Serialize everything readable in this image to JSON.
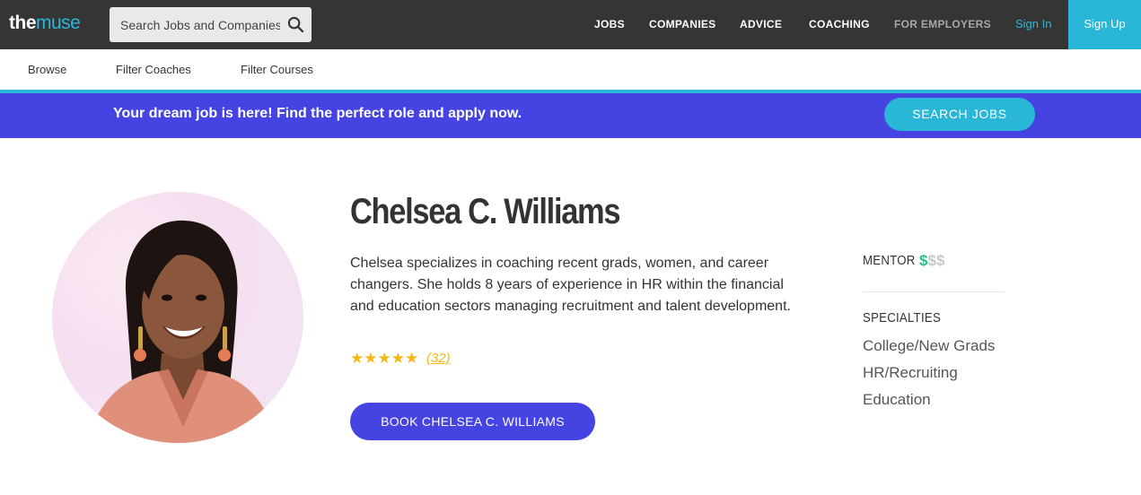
{
  "header": {
    "logo_the": "the",
    "logo_muse": "muse",
    "search_placeholder": "Search Jobs and Companies",
    "nav": [
      "JOBS",
      "COMPANIES",
      "ADVICE",
      "COACHING",
      "FOR EMPLOYERS"
    ],
    "sign_in": "Sign In",
    "sign_up": "Sign Up"
  },
  "subnav": [
    "Browse",
    "Filter Coaches",
    "Filter Courses"
  ],
  "banner": {
    "text": "Your dream job is here! Find the perfect role and apply now.",
    "button": "SEARCH JOBS"
  },
  "profile": {
    "name": "Chelsea C. Williams",
    "bio": "Chelsea specializes in coaching recent grads, women, and career changers. She holds 8 years of experience in HR within the financial and education sectors managing recruitment and talent development.",
    "rating_stars": 5,
    "review_count": "(32)",
    "book_button": "BOOK CHELSEA C. WILLIAMS"
  },
  "sidebar": {
    "level_label": "MENTOR",
    "price_level": 1,
    "price_max": 3,
    "specialties_label": "SPECIALTIES",
    "specialties": [
      "College/New Grads",
      "HR/Recruiting",
      "Education"
    ]
  },
  "colors": {
    "header_bg": "#353535",
    "brand_cyan": "#2ab6d6",
    "banner_purple": "#4543e2",
    "star_gold": "#f5b915",
    "price_green": "#2abf8a"
  },
  "icons": [
    "search-icon",
    "star-icon",
    "dollar-icon"
  ]
}
